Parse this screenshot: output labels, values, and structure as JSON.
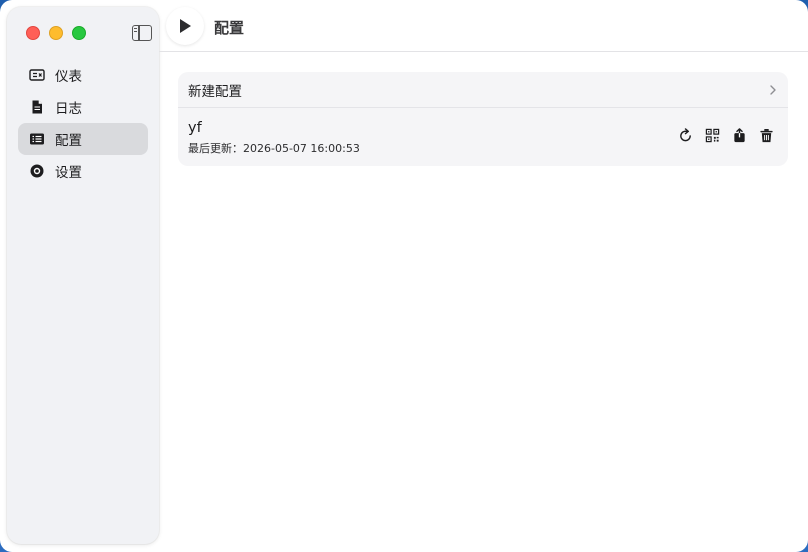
{
  "window": {
    "title": "配置"
  },
  "sidebar": {
    "items": [
      {
        "label": "仪表",
        "icon": "dashboard-icon",
        "active": false
      },
      {
        "label": "日志",
        "icon": "document-icon",
        "active": false
      },
      {
        "label": "配置",
        "icon": "list-icon",
        "active": true
      },
      {
        "label": "设置",
        "icon": "gear-icon",
        "active": false
      }
    ]
  },
  "toolbar": {
    "play_icon": "play-icon"
  },
  "profiles": {
    "new_label": "新建配置",
    "items": [
      {
        "name": "yf",
        "updated": "最后更新：2026-05-07 16:00:53",
        "actions": [
          "refresh-icon",
          "qrcode-icon",
          "share-icon",
          "trash-icon"
        ]
      }
    ]
  },
  "colors": {
    "close": "#ff5f57",
    "minimize": "#febc2e",
    "maximize": "#28c840",
    "active_row": "#d9dadd",
    "card_bg": "#f5f5f7"
  }
}
